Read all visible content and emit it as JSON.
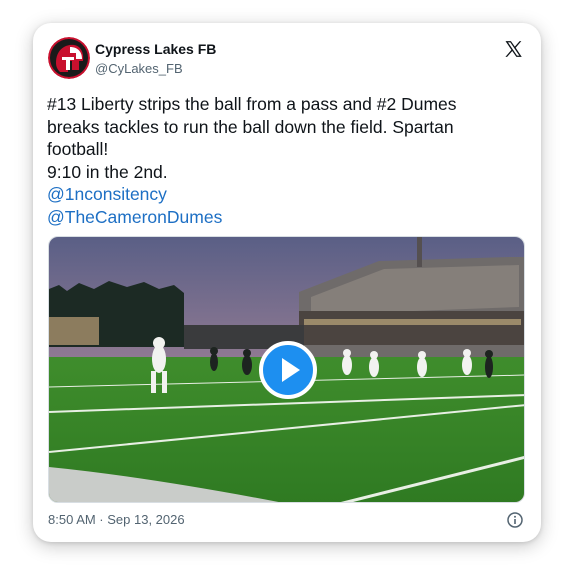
{
  "account": {
    "name": "Cypress Lakes FB",
    "handle": "@CyLakes_FB"
  },
  "tweet": {
    "line1": "#13 Liberty strips the ball from a pass and #2 Dumes",
    "line2": "breaks tackles to run the ball down the field.  Spartan",
    "line3": "football!",
    "line4": "9:10 in the 2nd.",
    "mention1": "@1nconsitency",
    "mention2": "@TheCameronDumes"
  },
  "media": {
    "type": "video",
    "icon": "play-icon"
  },
  "footer": {
    "timestamp": "8:50 AM · Sep 13, 2026"
  },
  "colors": {
    "mention": "#1d6fc4",
    "play_button": "#1d8ff0",
    "avatar_bg": "#c8102e"
  }
}
